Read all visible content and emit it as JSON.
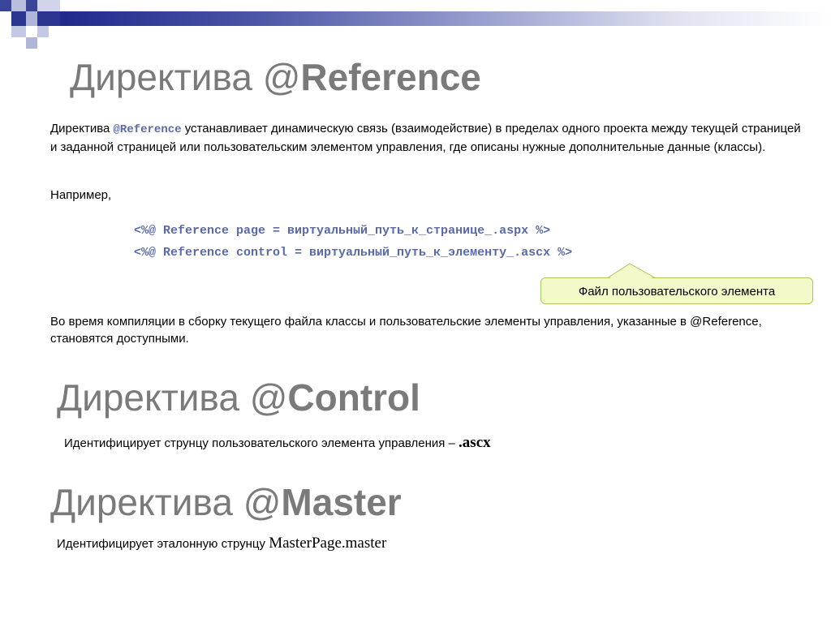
{
  "section1": {
    "title_prefix": "Директива ",
    "title_at": "@",
    "title_keyword": "Reference",
    "paragraph1": {
      "before": "Директива ",
      "code": "@Reference",
      "after": " устанавливает динамическую связь (взаимодействие) в пределах одного проекта между текущей страницей и заданной страницей или пользовательским элементом управления, где описаны нужные дополнительные данные (классы)."
    },
    "example_label": "Например,",
    "code_line1": "<%@ Reference page = виртуальный_путь_к_странице_.aspx %>",
    "code_line2": "<%@ Reference control = виртуальный_путь_к_элементу_.ascx %>",
    "callout": "Файл пользовательского элемента",
    "paragraph3": "Во время компиляции в сборку текущего файла классы и пользовательские элементы управления, указанные в @Reference, становятся доступными."
  },
  "section2": {
    "title_prefix": "Директива ",
    "title_at": "@",
    "title_keyword": "Control",
    "text": "Идентифицирует струнцу пользовательского элемента управления – ",
    "text_strong": ".ascx"
  },
  "section3": {
    "title_prefix": "Директива ",
    "title_at": "@",
    "title_keyword": "Master",
    "text": "Идентифицирует эталонную струнцу ",
    "text_strong": "MasterPage.master"
  },
  "colors": {
    "header_band_dark": "#1f2a8c",
    "title_gray": "#7a7a7a",
    "code_blue": "#5a6aa6",
    "callout_fill": "#f4f9c9",
    "callout_border": "#a8c85a"
  }
}
